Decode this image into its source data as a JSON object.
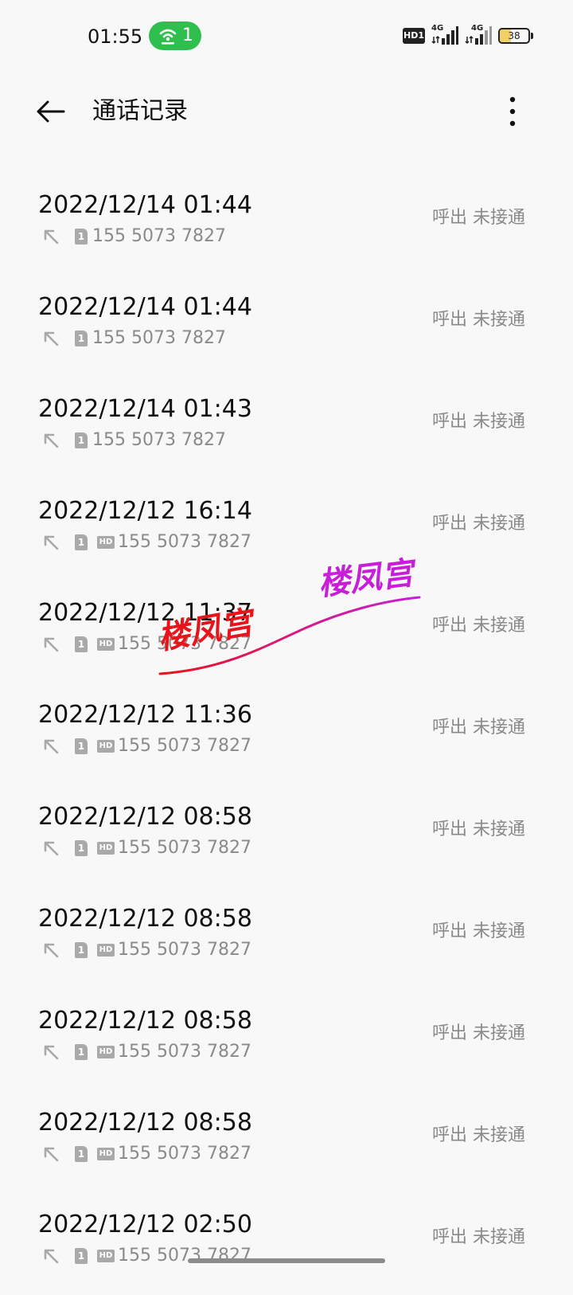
{
  "status_bar": {
    "time": "01:55",
    "hotspot_count": "1",
    "hd_label": "HD1",
    "network_1": "4G",
    "network_2": "4G",
    "battery_level": "38",
    "battery_fraction": 0.38
  },
  "app_bar": {
    "title": "通话记录",
    "back_icon": "arrow-left-icon",
    "menu_icon": "more-vertical-icon"
  },
  "calls": [
    {
      "datetime": "2022/12/14 01:44",
      "number": "155 5073 7827",
      "status": "呼出 未接通",
      "sim": "1",
      "hd": false
    },
    {
      "datetime": "2022/12/14 01:44",
      "number": "155 5073 7827",
      "status": "呼出 未接通",
      "sim": "1",
      "hd": false
    },
    {
      "datetime": "2022/12/14 01:43",
      "number": "155 5073 7827",
      "status": "呼出 未接通",
      "sim": "1",
      "hd": false
    },
    {
      "datetime": "2022/12/12 16:14",
      "number": "155 5073 7827",
      "status": "呼出 未接通",
      "sim": "1",
      "hd": true
    },
    {
      "datetime": "2022/12/12 11:37",
      "number": "155 5073 7827",
      "status": "呼出 未接通",
      "sim": "1",
      "hd": true
    },
    {
      "datetime": "2022/12/12 11:36",
      "number": "155 5073 7827",
      "status": "呼出 未接通",
      "sim": "1",
      "hd": true
    },
    {
      "datetime": "2022/12/12 08:58",
      "number": "155 5073 7827",
      "status": "呼出 未接通",
      "sim": "1",
      "hd": true
    },
    {
      "datetime": "2022/12/12 08:58",
      "number": "155 5073 7827",
      "status": "呼出 未接通",
      "sim": "1",
      "hd": true
    },
    {
      "datetime": "2022/12/12 08:58",
      "number": "155 5073 7827",
      "status": "呼出 未接通",
      "sim": "1",
      "hd": true
    },
    {
      "datetime": "2022/12/12 08:58",
      "number": "155 5073 7827",
      "status": "呼出 未接通",
      "sim": "1",
      "hd": true
    },
    {
      "datetime": "2022/12/12 02:50",
      "number": "155 5073 7827",
      "status": "呼出 未接通",
      "sim": "1",
      "hd": true
    }
  ],
  "hd_icon_label": "HD",
  "watermark": {
    "text_1": "楼凤宫",
    "text_2": "楼凤宫",
    "color_1": "#e8141c",
    "color_2": "#c81ed9"
  },
  "colors": {
    "background": "#f8f8f8",
    "hotspot_green": "#2fbf4f",
    "secondary_text": "#8a8a8a",
    "battery_fill": "#f0cf6a"
  }
}
